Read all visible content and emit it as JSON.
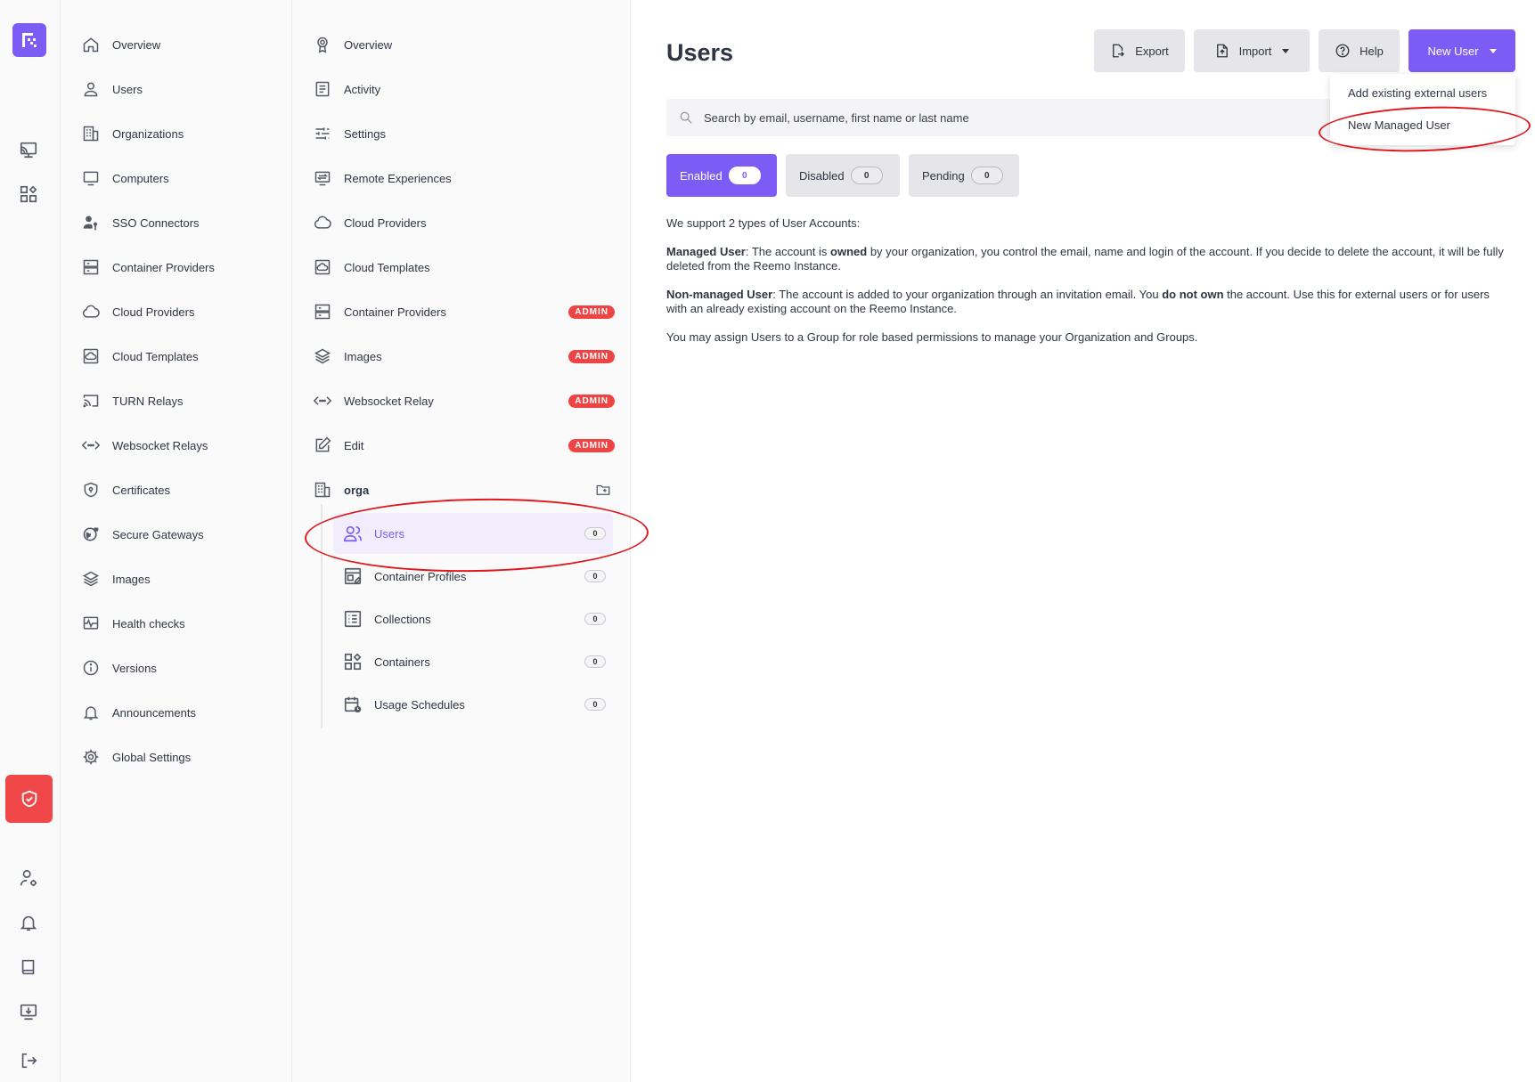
{
  "rail": {
    "icons": [
      "logo-icon",
      "cast-icon",
      "apps-icon",
      "shield-icon",
      "user-settings-icon",
      "bell-icon",
      "book-icon",
      "download-icon",
      "logout-icon"
    ]
  },
  "admin_nav": {
    "items": [
      {
        "label": "Overview",
        "icon": "home-icon"
      },
      {
        "label": "Users",
        "icon": "user-icon"
      },
      {
        "label": "Organizations",
        "icon": "building-icon"
      },
      {
        "label": "Computers",
        "icon": "monitor-icon"
      },
      {
        "label": "SSO Connectors",
        "icon": "user-key-icon"
      },
      {
        "label": "Container Providers",
        "icon": "server-icon"
      },
      {
        "label": "Cloud Providers",
        "icon": "cloud-icon"
      },
      {
        "label": "Cloud Templates",
        "icon": "cloud-template-icon"
      },
      {
        "label": "TURN Relays",
        "icon": "cast-icon"
      },
      {
        "label": "Websocket Relays",
        "icon": "code-dots-icon"
      },
      {
        "label": "Certificates",
        "icon": "certificate-shield-icon"
      },
      {
        "label": "Secure Gateways",
        "icon": "globe-lock-icon"
      },
      {
        "label": "Images",
        "icon": "layers-icon"
      },
      {
        "label": "Health checks",
        "icon": "pulse-icon"
      },
      {
        "label": "Versions",
        "icon": "info-icon"
      },
      {
        "label": "Announcements",
        "icon": "bell-icon"
      },
      {
        "label": "Global Settings",
        "icon": "gear-icon"
      }
    ]
  },
  "org_nav": {
    "items": [
      {
        "label": "Overview",
        "icon": "award-icon",
        "badge": ""
      },
      {
        "label": "Activity",
        "icon": "document-list-icon",
        "badge": ""
      },
      {
        "label": "Settings",
        "icon": "sliders-icon",
        "badge": ""
      },
      {
        "label": "Remote Experiences",
        "icon": "remote-icon",
        "badge": ""
      },
      {
        "label": "Cloud Providers",
        "icon": "cloud-icon",
        "badge": ""
      },
      {
        "label": "Cloud Templates",
        "icon": "cloud-template-icon",
        "badge": ""
      },
      {
        "label": "Container Providers",
        "icon": "server-icon",
        "badge": "ADMIN"
      },
      {
        "label": "Images",
        "icon": "layers-icon",
        "badge": "ADMIN"
      },
      {
        "label": "Websocket Relay",
        "icon": "code-dots-icon",
        "badge": "ADMIN"
      },
      {
        "label": "Edit",
        "icon": "edit-icon",
        "badge": "ADMIN"
      }
    ],
    "org_name": "orga",
    "sub_items": [
      {
        "label": "Users",
        "icon": "users-icon",
        "count": "0"
      },
      {
        "label": "Container Profiles",
        "icon": "container-profile-icon",
        "count": "0"
      },
      {
        "label": "Collections",
        "icon": "list-icon",
        "count": "0"
      },
      {
        "label": "Containers",
        "icon": "apps-icon",
        "count": "0"
      },
      {
        "label": "Usage Schedules",
        "icon": "calendar-clock-icon",
        "count": "0"
      }
    ]
  },
  "main": {
    "title": "Users",
    "toolbar": {
      "export": "Export",
      "import": "Import",
      "help": "Help",
      "new_user": "New User"
    },
    "new_user_menu": [
      "Add existing external users",
      "New Managed User"
    ],
    "search_placeholder": "Search by email, username, first name or last name",
    "tabs": [
      {
        "label": "Enabled",
        "count": "0"
      },
      {
        "label": "Disabled",
        "count": "0"
      },
      {
        "label": "Pending",
        "count": "0"
      }
    ],
    "info": {
      "intro": "We support 2 types of User Accounts:",
      "managed_title": "Managed User",
      "managed_p1": ": The account is ",
      "managed_bold": "owned",
      "managed_p2": " by your organization, you control the email, name and login of the account. If you decide to delete the account, it will be fully deleted from the Reemo Instance.",
      "nonmanaged_title": "Non-managed User",
      "nonmanaged_p1": ": The account is added to your organization through an invitation email. You ",
      "nonmanaged_bold": "do not own",
      "nonmanaged_p2": " the account. Use this for external users or for users with an already existing account on the Reemo Instance.",
      "groups": "You may assign Users to a Group for role based permissions to manage your Organization and Groups."
    }
  },
  "colors": {
    "accent": "#7c5cf5",
    "danger": "#ef4444",
    "annotation": "#e0191e"
  }
}
